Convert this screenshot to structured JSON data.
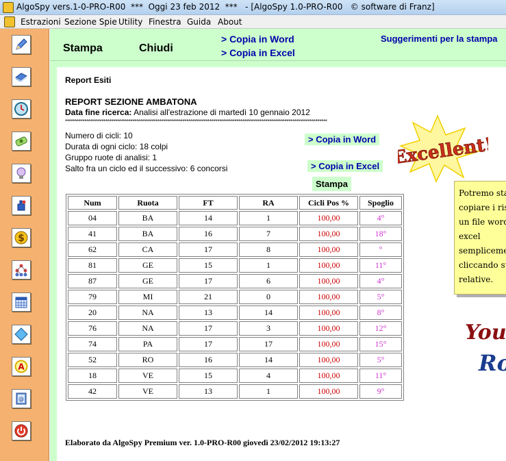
{
  "window": {
    "title": "AlgoSpy vers.1-0-PRO-R00  ***  Oggi 23 feb 2012  ***   - [AlgoSpy 1.0-PRO-R00   © software di Franz]"
  },
  "menu": [
    "Estrazioni",
    "Sezione Spie",
    "Utility",
    "Finestra",
    "Guida",
    "About"
  ],
  "sidebar": {
    "icons": [
      "pencil-icon",
      "book-icon",
      "clock-icon",
      "banknote-icon",
      "lightbulb-icon",
      "hand-icon",
      "dollar-icon",
      "network-icon",
      "calendar-icon",
      "diamond-icon",
      "letter-a-icon",
      "address-book-icon",
      "power-icon"
    ]
  },
  "toolbar": {
    "stampa": "Stampa",
    "chiudi": "Chiudi",
    "copia_word": "> Copia in Word",
    "copia_excel": "> Copia in Excel",
    "suggerimenti": "Suggerimenti per la stampa"
  },
  "report": {
    "title": "Report Esiti",
    "section": "REPORT  SEZIONE AMBATONA",
    "data_fine_label": "Data fine ricerca:",
    "data_fine_value": " Analisi all'estrazione di martedì 10 gennaio 2012",
    "stars": "****************************************************************************************************************************************",
    "info": [
      "Numero di cicli: 10",
      "Durata di ogni ciclo: 18 colpi",
      "Gruppo ruote di analisi: 1",
      "Salto fra un ciclo ed il successivo: 6 concorsi"
    ],
    "btn_word": "> Copia in Word",
    "btn_excel": "> Copia in Excel",
    "btn_stampa": "Stampa",
    "footer": "Elaborato da AlgoSpy Premium ver. 1.0-PRO-R00  giovedì 23/02/2012 19:13:27"
  },
  "table": {
    "headers": [
      "Num",
      "Ruota",
      "FT",
      "RA",
      "Cicli Pos %",
      "Spoglio"
    ],
    "rows": [
      [
        "04",
        "BA",
        "14",
        "1",
        "100,00",
        "4°"
      ],
      [
        "41",
        "BA",
        "16",
        "7",
        "100,00",
        "18°"
      ],
      [
        "62",
        "CA",
        "17",
        "8",
        "100,00",
        "°"
      ],
      [
        "81",
        "GE",
        "15",
        "1",
        "100,00",
        "11°"
      ],
      [
        "87",
        "GE",
        "17",
        "6",
        "100,00",
        "4°"
      ],
      [
        "79",
        "MI",
        "21",
        "0",
        "100,00",
        "5°"
      ],
      [
        "20",
        "NA",
        "13",
        "14",
        "100,00",
        "8°"
      ],
      [
        "76",
        "NA",
        "17",
        "3",
        "100,00",
        "12°"
      ],
      [
        "74",
        "PA",
        "17",
        "17",
        "100,00",
        "15°"
      ],
      [
        "52",
        "RO",
        "16",
        "14",
        "100,00",
        "5°"
      ],
      [
        "18",
        "VE",
        "15",
        "4",
        "100,00",
        "11°"
      ],
      [
        "42",
        "VE",
        "13",
        "1",
        "100,00",
        "9°"
      ]
    ]
  },
  "note": {
    "text": "Potremo stampare e  copiare i risultati in un file word oppure excel semplicemente cliccando sulle voci relative."
  },
  "badges": {
    "excellent": "Excellent!",
    "you": "You",
    "rock": "Rock"
  },
  "colors": {
    "sidebar": "#f5b16f",
    "panel": "#ccffcc",
    "link": "#0000aa",
    "cicli": "#cc0000",
    "spoglio": "#cc33cc",
    "note": "#ffff99"
  }
}
